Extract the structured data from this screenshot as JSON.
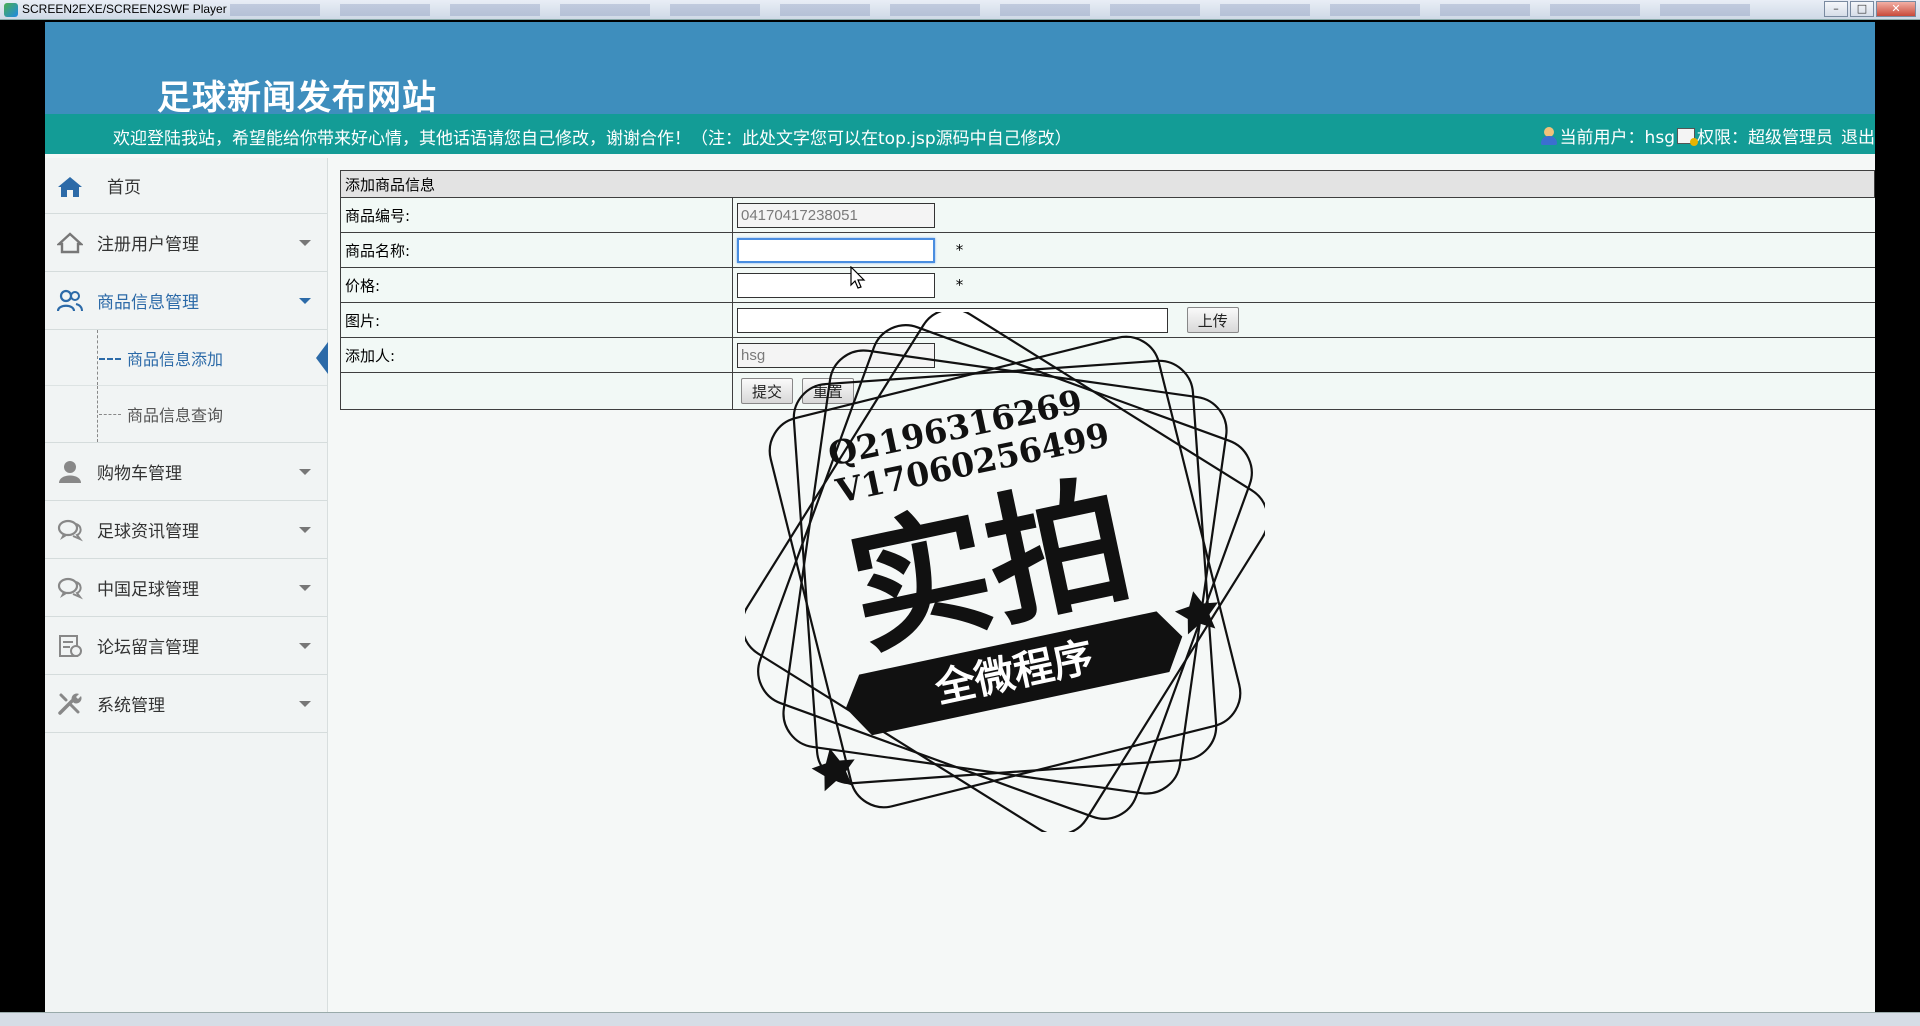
{
  "window": {
    "title": "SCREEN2EXE/SCREEN2SWF Player",
    "minimize": "–",
    "maximize": "□",
    "close": "✕"
  },
  "header": {
    "site_title": "足球新闻发布网站",
    "welcome": "欢迎登陆我站，希望能给你带来好心情，其他话语请您自己修改，谢谢合作！（注：此处文字您可以在top.jsp源码中自己修改）",
    "current_user": "当前用户：hsg",
    "permission": "权限：超级管理员",
    "logout": "退出"
  },
  "sidebar": {
    "home": "首页",
    "items": [
      {
        "label": "注册用户管理",
        "icon": "home-outline-icon"
      },
      {
        "label": "商品信息管理",
        "icon": "users-icon"
      },
      {
        "label": "购物车管理",
        "icon": "user-icon"
      },
      {
        "label": "足球资讯管理",
        "icon": "chat-icon"
      },
      {
        "label": "中国足球管理",
        "icon": "chat-icon"
      },
      {
        "label": "论坛留言管理",
        "icon": "notice-icon"
      },
      {
        "label": "系统管理",
        "icon": "tools-icon"
      }
    ],
    "submenu": [
      "商品信息添加",
      "商品信息查询"
    ]
  },
  "form": {
    "heading": "添加商品信息",
    "rows": [
      {
        "label": "商品编号:",
        "value": "04170417238051"
      },
      {
        "label": "商品名称:",
        "value": ""
      },
      {
        "label": "价格:",
        "value": ""
      },
      {
        "label": "图片:",
        "value": ""
      },
      {
        "label": "添加人:",
        "value": "hsg"
      }
    ],
    "required_mark": "*",
    "upload_button": "上传",
    "submit_button": "提交",
    "reset_button": "重置"
  },
  "watermark": {
    "line1": "Q2196316269",
    "line2": "V17060256499",
    "main": "实拍",
    "ribbon": "全微程序"
  },
  "colors": {
    "header_bg": "#3e8ebd",
    "welcome_bg": "#139c96",
    "accent": "#2c6aa8"
  }
}
